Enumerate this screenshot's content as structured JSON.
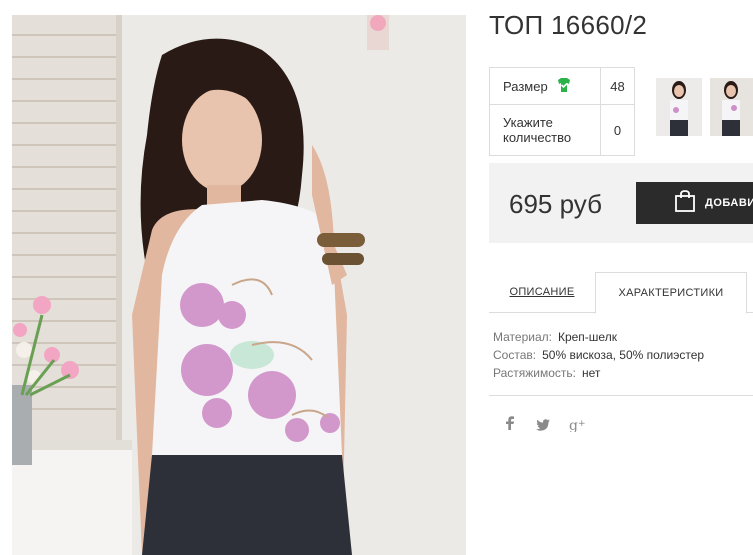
{
  "product": {
    "title": "ТОП 16660/2"
  },
  "options": {
    "size_label": "Размер",
    "size_value": "48",
    "quantity_label": "Укажите количество",
    "quantity_value": "0"
  },
  "purchase": {
    "price": "695 руб",
    "button_label": "ДОБАВИ"
  },
  "tabs": [
    {
      "label": "ОПИСАНИЕ"
    },
    {
      "label": "ХАРАКТЕРИСТИКИ"
    }
  ],
  "specs": [
    {
      "key": "Материал:",
      "value": "Креп-шелк"
    },
    {
      "key": "Состав:",
      "value": "50% вискоза, 50% полиэстер"
    },
    {
      "key": "Растяжимость:",
      "value": "нет"
    }
  ],
  "social": {
    "facebook": "f",
    "twitter": "🐦",
    "googleplus": "g+"
  },
  "colors": {
    "accent": "#2b2b2b",
    "size_icon": "#2bb34a",
    "price_bg": "#f2f2f2"
  }
}
